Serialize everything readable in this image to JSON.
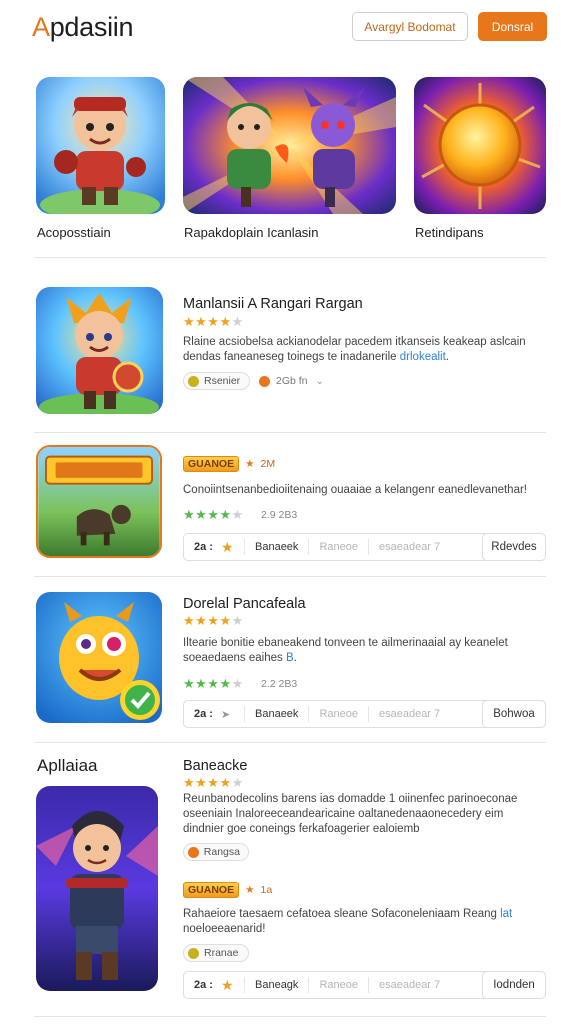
{
  "header": {
    "logo_prefix": "A",
    "logo_rest": "pdasiin",
    "outline_button": "Avargyl Bodomat",
    "solid_button": "Donsral"
  },
  "featured": [
    {
      "caption": "Acoposstiain",
      "icon": "hero-warrior-icon"
    },
    {
      "caption": "Rapakdoplain Icanlasin",
      "icon": "heroes-battle-icon"
    },
    {
      "caption": "Retindipans",
      "icon": "arena-emblem-icon"
    }
  ],
  "apps": [
    {
      "title": "Manlansii A Rangari Rargan",
      "stars": 4,
      "description": "Rlaine acsiobelsa ackianodelar pacedem itkanseis keakeap aslcain dendas faneaneseg toinegs te inadanerile ",
      "description_link": "drlokealit",
      "description_end": ".",
      "chip": "Rsenier",
      "meta": "2Gb fn"
    },
    {
      "title": "",
      "badge": "GUANOE",
      "badge_extra": "2M",
      "description": "Conoiintsenanbedioiitenaing ouaaiae a kelangenr eanedlevanethar!",
      "stars": 4,
      "rating": "2.9 2B3",
      "score": "2a :",
      "segments": [
        "Banaeek",
        "Raneoe",
        "esaeadear 7"
      ],
      "button": "Rdevdes"
    },
    {
      "title": "Dorelal Pancafeala",
      "stars": 4,
      "description": "Iltearie bonitie ebaneakend tonveen te ailmerinaaial ay keanelet soeaedaens eaihes",
      "description_link": "B",
      "description_end": ".",
      "stars2": 4,
      "rating": "2.2 2B3",
      "score": "2a :",
      "segments": [
        "Banaeek",
        "Raneoe",
        "esaeadear 7"
      ],
      "button": "Bohwoa"
    },
    {
      "section_label": "Apllaiaa",
      "title": "Baneacke",
      "stars": 4,
      "description": "Reunbanodecolins barens ias domadde 1 oiinenfec parinoeconae oseeniain Inaloreeceandearicaine oaltanedenaaonecedery eim dindnier goe coneings ferkafoagerier ealoiemb",
      "chip": "Rangsa",
      "badge": "GUANOE",
      "badge_extra": "1a",
      "description2": "Rahaeiore taesaem cefatoea sleane Sofaconeleniaam Reang ",
      "description2_link": "lat",
      "description2_line2": "noeloeeaenarid!",
      "chip2": "Rranae",
      "score": "2a :",
      "segments": [
        "Baneagk",
        "Raneoe",
        "esaeadear 7"
      ],
      "button": "Iodnden"
    }
  ],
  "colors": {
    "accent": "#e8771c",
    "star": "#f0a01c",
    "star_green": "#53b94b",
    "link": "#2c82d6"
  }
}
